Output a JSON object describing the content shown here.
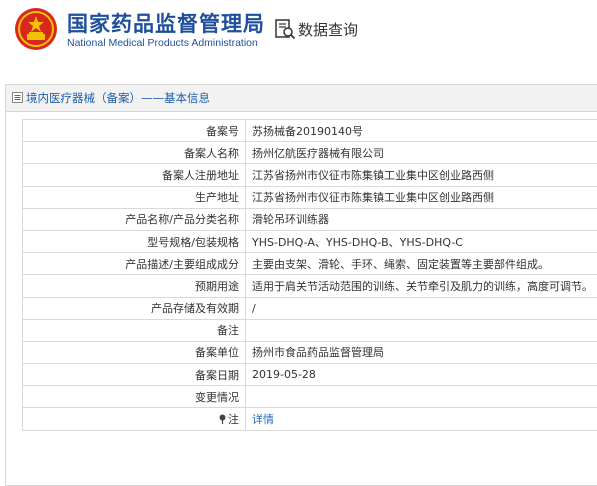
{
  "header": {
    "brand_cn": "国家药品监督管理局",
    "brand_en": "National Medical Products Administration",
    "query_label": "数据查询"
  },
  "panel": {
    "title": "境内医疗器械（备案）——基本信息"
  },
  "rows": [
    {
      "label": "备案号",
      "value": "苏扬械备20190140号"
    },
    {
      "label": "备案人名称",
      "value": "扬州亿航医疗器械有限公司"
    },
    {
      "label": "备案人注册地址",
      "value": "江苏省扬州市仪征市陈集镇工业集中区创业路西侧"
    },
    {
      "label": "生产地址",
      "value": "江苏省扬州市仪征市陈集镇工业集中区创业路西侧"
    },
    {
      "label": "产品名称/产品分类名称",
      "value": "滑轮吊环训练器"
    },
    {
      "label": "型号规格/包装规格",
      "value": "YHS-DHQ-A、YHS-DHQ-B、YHS-DHQ-C"
    },
    {
      "label": "产品描述/主要组成成分",
      "value": "主要由支架、滑轮、手环、绳索、固定装置等主要部件组成。"
    },
    {
      "label": "预期用途",
      "value": "适用于肩关节活动范围的训练、关节牵引及肌力的训练，高度可调节。"
    },
    {
      "label": "产品存储及有效期",
      "value": "/"
    },
    {
      "label": "备注",
      "value": ""
    },
    {
      "label": "备案单位",
      "value": "扬州市食品药品监督管理局"
    },
    {
      "label": "备案日期",
      "value": "2019-05-28"
    },
    {
      "label": "变更情况",
      "value": ""
    }
  ],
  "note_row": {
    "label": "注",
    "link": "详情"
  },
  "colors": {
    "brand_blue": "#1f4f9c",
    "emblem_red": "#d8281e",
    "emblem_gold": "#f2c200",
    "link": "#2a6ac0"
  }
}
